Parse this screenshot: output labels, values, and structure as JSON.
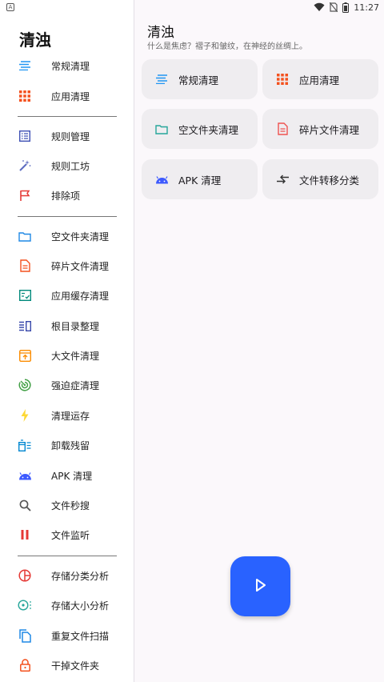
{
  "status_bar": {
    "time": "11:27",
    "indicator": "A"
  },
  "drawer": {
    "title": "清浊",
    "items": [
      {
        "label": "常规清理",
        "icon": "lines-icon",
        "color": "#2196f3"
      },
      {
        "label": "应用清理",
        "icon": "grid-icon",
        "color": "#f4511e"
      },
      {
        "label": "规则管理",
        "icon": "list-box-icon",
        "color": "#3f51b5"
      },
      {
        "label": "规则工坊",
        "icon": "magic-wand-icon",
        "color": "#5c6bc0"
      },
      {
        "label": "排除项",
        "icon": "flag-icon",
        "color": "#e53935"
      },
      {
        "label": "空文件夹清理",
        "icon": "folder-icon",
        "color": "#1e88e5"
      },
      {
        "label": "碎片文件清理",
        "icon": "document-icon",
        "color": "#f4511e"
      },
      {
        "label": "应用缓存清理",
        "icon": "checklist-icon",
        "color": "#00897b"
      },
      {
        "label": "根目录整理",
        "icon": "columns-icon",
        "color": "#3949ab"
      },
      {
        "label": "大文件清理",
        "icon": "archive-icon",
        "color": "#fb8c00"
      },
      {
        "label": "强迫症清理",
        "icon": "radar-icon",
        "color": "#43a047"
      },
      {
        "label": "清理运存",
        "icon": "flash-icon",
        "color": "#fdd835"
      },
      {
        "label": "卸载残留",
        "icon": "uninstall-icon",
        "color": "#0288d1"
      },
      {
        "label": "APK 清理",
        "icon": "android-icon",
        "color": "#3d5afe"
      },
      {
        "label": "文件秒搜",
        "icon": "search-icon",
        "color": "#555555"
      },
      {
        "label": "文件监听",
        "icon": "pause-icon",
        "color": "#e53935"
      },
      {
        "label": "存储分类分析",
        "icon": "pie-chart-icon",
        "color": "#e53935"
      },
      {
        "label": "存储大小分析",
        "icon": "dots-circle-icon",
        "color": "#26a69a"
      },
      {
        "label": "重复文件扫描",
        "icon": "copy-icon",
        "color": "#1e88e5"
      },
      {
        "label": "干掉文件夹",
        "icon": "lock-icon",
        "color": "#f4511e"
      }
    ]
  },
  "main": {
    "title": "清浊",
    "subtitle": "什么是焦虑？褶子和皱纹，在神经的丝绸上。",
    "cards": [
      {
        "label": "常规清理",
        "icon": "lines-icon",
        "color": "#2196f3"
      },
      {
        "label": "应用清理",
        "icon": "grid-icon",
        "color": "#f4511e"
      },
      {
        "label": "空文件夹清理",
        "icon": "folder-icon",
        "color": "#26a69a"
      },
      {
        "label": "碎片文件清理",
        "icon": "document-icon",
        "color": "#ef5350"
      },
      {
        "label": "APK 清理",
        "icon": "android-icon",
        "color": "#3d5afe"
      },
      {
        "label": "文件转移分类",
        "icon": "transfer-icon",
        "color": "#333333"
      }
    ],
    "fab_icon": "play-icon",
    "fab_color": "#2962ff"
  }
}
